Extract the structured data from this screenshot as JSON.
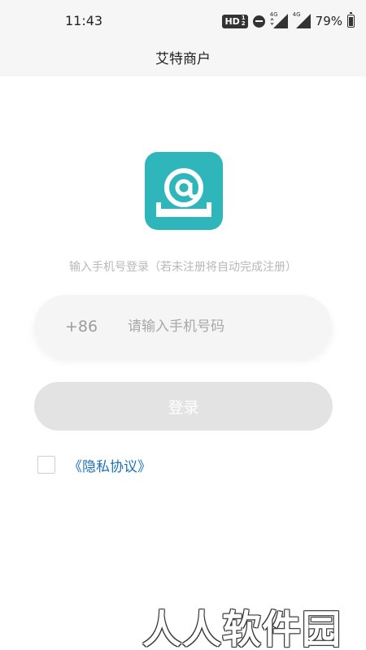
{
  "status_bar": {
    "time": "11:43",
    "hd_label": "HD",
    "hd_frac_top": "1",
    "hd_frac_bottom": "2",
    "signal1_label": "4G",
    "signal2_label": "4G",
    "battery_percent": "79%",
    "battery_level": 0.79
  },
  "header": {
    "title": "艾特商户"
  },
  "logo": {
    "icon": "at-sign-icon",
    "bg_color": "#2fb6ba"
  },
  "login": {
    "subtitle": "输入手机号登录（若未注册将自动完成注册）",
    "country_code": "+86",
    "phone_value": "",
    "phone_placeholder": "请输入手机号码",
    "submit_label": "登录"
  },
  "agreement": {
    "checked": false,
    "link_label": "《隐私协议》",
    "link_color": "#1b72b8"
  },
  "watermark": {
    "text": "人人软件园"
  }
}
